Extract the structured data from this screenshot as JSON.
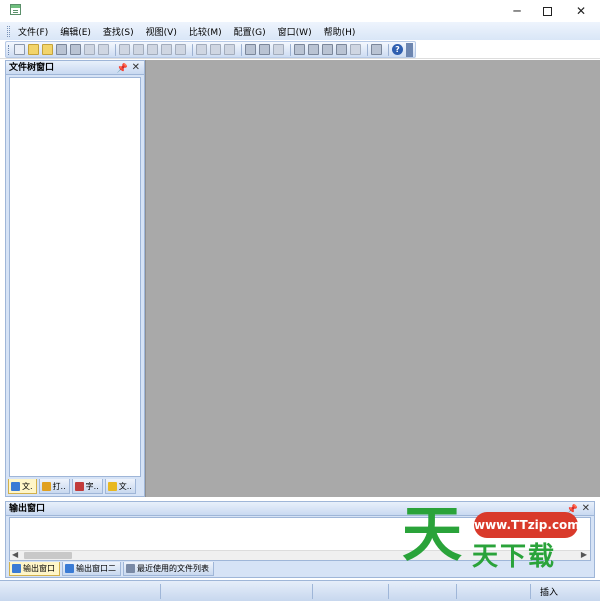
{
  "window": {
    "minimize": "─",
    "close": "✕"
  },
  "menu": [
    "文件(F)",
    "编辑(E)",
    "查找(S)",
    "视图(V)",
    "比较(M)",
    "配置(G)",
    "窗口(W)",
    "帮助(H)"
  ],
  "toolbar": {
    "help": "?"
  },
  "tree_panel": {
    "title": "文件树窗口",
    "pin": "📌",
    "close": "✕",
    "tabs": [
      {
        "label": "文.",
        "icon": "tree-icon",
        "color": "#3a7bd5"
      },
      {
        "label": "打..",
        "icon": "open-file-icon",
        "color": "#e0a020"
      },
      {
        "label": "字..",
        "icon": "chart-icon",
        "color": "#c23b3b"
      },
      {
        "label": "文..",
        "icon": "star-icon",
        "color": "#e8b820"
      }
    ]
  },
  "output_panel": {
    "title": "输出窗口",
    "pin": "📌",
    "close": "✕",
    "tabs": [
      {
        "label": "输出窗口",
        "icon": "output-icon",
        "color": "#3a7bd5"
      },
      {
        "label": "输出窗口二",
        "icon": "output2-icon",
        "color": "#3a7bd5"
      },
      {
        "label": "最近使用的文件列表",
        "icon": "recent-files-icon",
        "color": "#7a8aa6"
      }
    ]
  },
  "status": {
    "insert": "插入"
  },
  "watermark": {
    "big": "天",
    "url": "www.TTzip.com",
    "sub": "天下载"
  }
}
